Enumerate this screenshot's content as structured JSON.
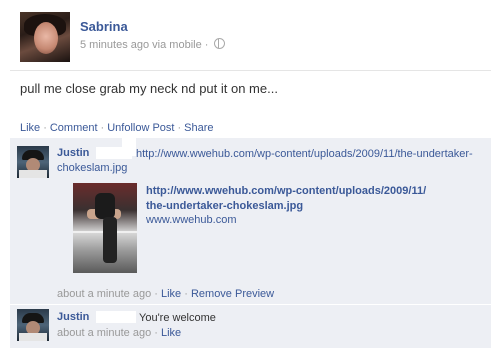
{
  "post": {
    "author": "Sabrina",
    "time": "5 minutes ago",
    "via": "via mobile",
    "text": "pull me close grab my neck nd put it on me..."
  },
  "actions": {
    "like": "Like",
    "comment": "Comment",
    "unfollow": "Unfollow Post",
    "share": "Share"
  },
  "comments": [
    {
      "author": "Justin",
      "text_line1": "http://www.wwehub.com/wp-content/uploads/2009/11/the-undertaker-",
      "text_line2": "chokeslam.jpg",
      "preview": {
        "title_line1": "http://www.wwehub.com/wp-content/uploads/2009/11/",
        "title_line2": "the-undertaker-chokeslam.jpg",
        "domain": "www.wwehub.com"
      },
      "time": "about a minute ago",
      "like": "Like",
      "remove_preview": "Remove Preview"
    },
    {
      "author": "Justin",
      "text": "You're welcome",
      "time": "about a minute ago",
      "like": "Like"
    }
  ],
  "icons": {
    "globe": "globe-icon"
  },
  "colors": {
    "link": "#3b5998",
    "muted": "#999999",
    "comment_bg": "#edeff4"
  }
}
